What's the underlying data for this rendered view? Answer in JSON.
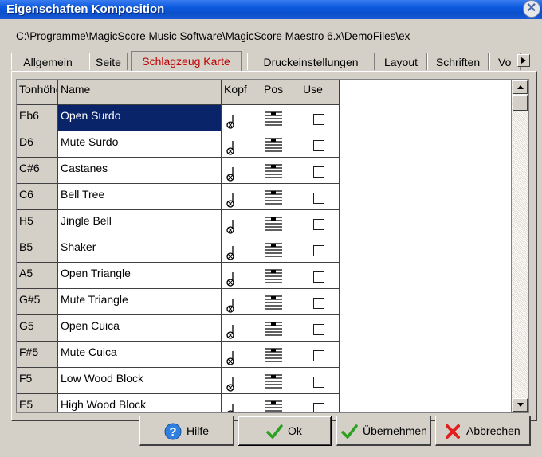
{
  "window": {
    "title": "Eigenschaften Komposition"
  },
  "path": "C:\\Programme\\MagicScore Music Software\\MagicScore Maestro 6.x\\DemoFiles\\ex",
  "tabs": [
    {
      "label": "Allgemein",
      "active": false
    },
    {
      "label": "Seite",
      "active": false
    },
    {
      "label": "Schlagzeug Karte",
      "active": true
    },
    {
      "label": "Druckeinstellungen",
      "active": false
    },
    {
      "label": "Layout",
      "active": false
    },
    {
      "label": "Schriften",
      "active": false
    },
    {
      "label": "Vo",
      "active": false
    }
  ],
  "grid": {
    "headers": {
      "key": "Tonhöhe",
      "name": "Name",
      "kopf": "Kopf",
      "pos": "Pos",
      "use": "Use"
    },
    "rows": [
      {
        "key": "Eb6",
        "name": "Open Surdo",
        "selected": true
      },
      {
        "key": "D6",
        "name": "Mute Surdo"
      },
      {
        "key": "C#6",
        "name": "Castanes"
      },
      {
        "key": "C6",
        "name": "Bell Tree"
      },
      {
        "key": "H5",
        "name": "Jingle Bell"
      },
      {
        "key": "B5",
        "name": "Shaker"
      },
      {
        "key": "A5",
        "name": "Open Triangle"
      },
      {
        "key": "G#5",
        "name": "Mute Triangle"
      },
      {
        "key": "G5",
        "name": "Open Cuica"
      },
      {
        "key": "F#5",
        "name": "Mute Cuica"
      },
      {
        "key": "F5",
        "name": "Low Wood Block"
      },
      {
        "key": "E5",
        "name": "High Wood Block"
      }
    ]
  },
  "buttons": {
    "help": "Hilfe",
    "ok": "Ok",
    "apply": "Übernehmen",
    "cancel": "Abbrechen"
  },
  "icons": {
    "help": "help-icon",
    "ok": "checkmark-icon",
    "apply": "checkmark-icon",
    "cancel": "x-icon"
  }
}
